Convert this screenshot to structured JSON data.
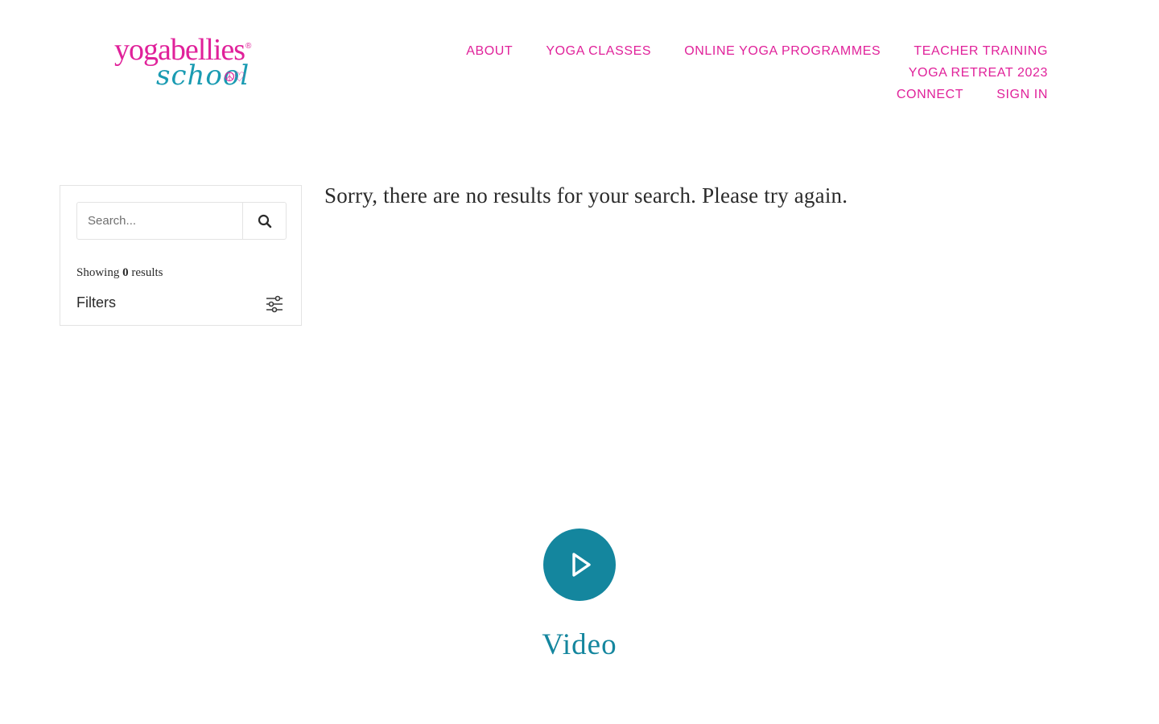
{
  "brand": {
    "logo_top": "yogabellies",
    "logo_bottom": "school",
    "registered": "®",
    "accent_color": "#e0219a",
    "secondary_color": "#1a9bb2"
  },
  "nav": {
    "items": [
      {
        "label": "ABOUT"
      },
      {
        "label": "YOGA CLASSES"
      },
      {
        "label": "ONLINE YOGA PROGRAMMES"
      },
      {
        "label": "TEACHER TRAINING"
      },
      {
        "label": "YOGA RETREAT 2023"
      },
      {
        "label": "CONNECT"
      },
      {
        "label": "SIGN IN"
      }
    ]
  },
  "sidebar": {
    "search": {
      "placeholder": "Search...",
      "value": "",
      "icon": "search-icon"
    },
    "showing_prefix": "Showing",
    "showing_count": "0",
    "showing_suffix": "results",
    "filters_label": "Filters",
    "filters_icon": "sliders-icon"
  },
  "main": {
    "message": "Sorry, there are no results for your search. Please try again."
  },
  "video": {
    "label": "Video",
    "icon": "play-icon",
    "color": "#14869e"
  }
}
